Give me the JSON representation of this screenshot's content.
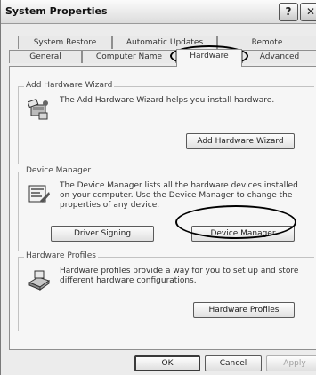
{
  "window": {
    "title": "System Properties",
    "help_btn": "?",
    "close_btn": "✕"
  },
  "tabs": {
    "row1": [
      "System Restore",
      "Automatic Updates",
      "Remote"
    ],
    "row2": [
      "General",
      "Computer Name",
      "Hardware",
      "Advanced"
    ],
    "active": "Hardware"
  },
  "add_hardware": {
    "legend": "Add Hardware Wizard",
    "text": "The Add Hardware Wizard helps you install hardware.",
    "button": "Add Hardware Wizard",
    "icon": "add-hardware-icon"
  },
  "device_manager": {
    "legend": "Device Manager",
    "text": "The Device Manager lists all the hardware devices installed on your computer. Use the Device Manager to change the properties of any device.",
    "driver_signing": "Driver Signing",
    "button": "Device Manager",
    "icon": "device-manager-icon"
  },
  "profiles": {
    "legend": "Hardware Profiles",
    "text": "Hardware profiles provide a way for you to set up and store different hardware configurations.",
    "button": "Hardware Profiles",
    "icon": "hardware-profiles-icon"
  },
  "footer": {
    "ok": "OK",
    "cancel": "Cancel",
    "apply": "Apply"
  },
  "colors": {
    "annotation": "#000000",
    "dialog_bg": "#ececec",
    "panel_bg": "#f6f6f6"
  }
}
